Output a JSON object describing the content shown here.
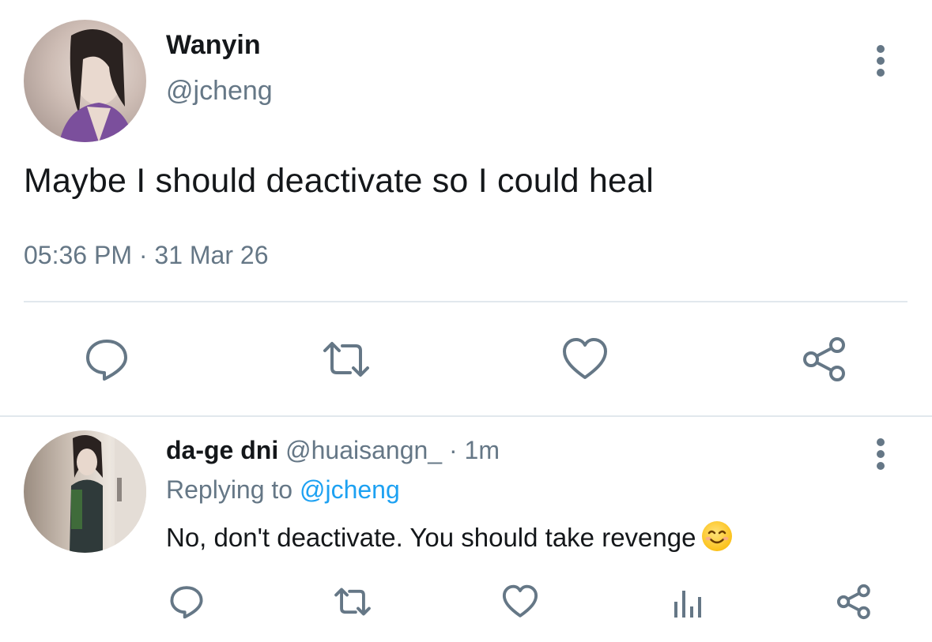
{
  "tweet": {
    "author_name": "Wanyin",
    "author_handle": "@jcheng",
    "text": "Maybe I should deactivate so I could heal",
    "timestamp": "05:36 PM · 31 Mar 26"
  },
  "actions": {
    "icons": [
      "reply-icon",
      "retweet-icon",
      "like-icon",
      "share-icon"
    ]
  },
  "reply": {
    "author_name": "da-ge dni",
    "meta": " @huaisangn_ · 1m",
    "replying_prefix": "Replying to ",
    "replying_mention": "@jcheng",
    "text": "No, don't deactivate. You should take revenge",
    "emoji": "smiling-face-emoji",
    "icons": [
      "reply-icon",
      "retweet-icon",
      "like-icon",
      "analytics-icon",
      "share-icon"
    ]
  },
  "colors": {
    "text_primary": "#14171a",
    "text_secondary": "#657786",
    "link": "#1da1f2",
    "divider": "#e1e8ed",
    "icon": "#657786"
  }
}
